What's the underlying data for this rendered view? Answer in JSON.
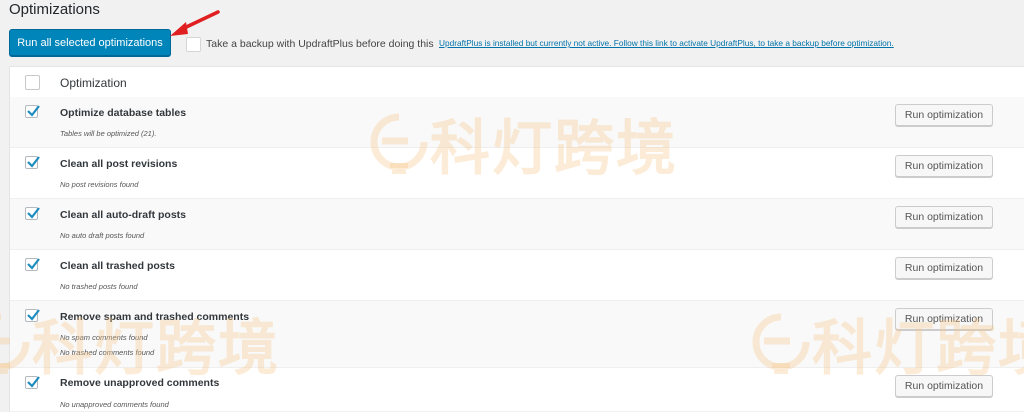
{
  "page": {
    "title": "Optimizations"
  },
  "toolbar": {
    "run_all_label": "Run all selected optimizations",
    "backup_label": "Take a backup with UpdraftPlus before doing this",
    "backup_link": "UpdraftPlus is installed but currently not active. Follow this link to activate UpdraftPlus, to take a backup before optimization."
  },
  "table": {
    "header": "Optimization",
    "button_label": "Run optimization",
    "rows": [
      {
        "title": "Optimize database tables",
        "desc": [
          "Tables will be optimized (21)."
        ],
        "checked": true
      },
      {
        "title": "Clean all post revisions",
        "desc": [
          "No post revisions found"
        ],
        "checked": true
      },
      {
        "title": "Clean all auto-draft posts",
        "desc": [
          "No auto draft posts found"
        ],
        "checked": true
      },
      {
        "title": "Clean all trashed posts",
        "desc": [
          "No trashed posts found"
        ],
        "checked": true
      },
      {
        "title": "Remove spam and trashed comments",
        "desc": [
          "No spam comments found",
          "No trashed comments found"
        ],
        "checked": true
      },
      {
        "title": "Remove unapproved comments",
        "desc": [
          "No unapproved comments found"
        ],
        "checked": true
      }
    ]
  },
  "watermark": {
    "text": "科灯跨境"
  },
  "colors": {
    "primary": "#0085ba",
    "link": "#0073aa",
    "check": "#1e8cbe",
    "arrow": "#e02020"
  }
}
